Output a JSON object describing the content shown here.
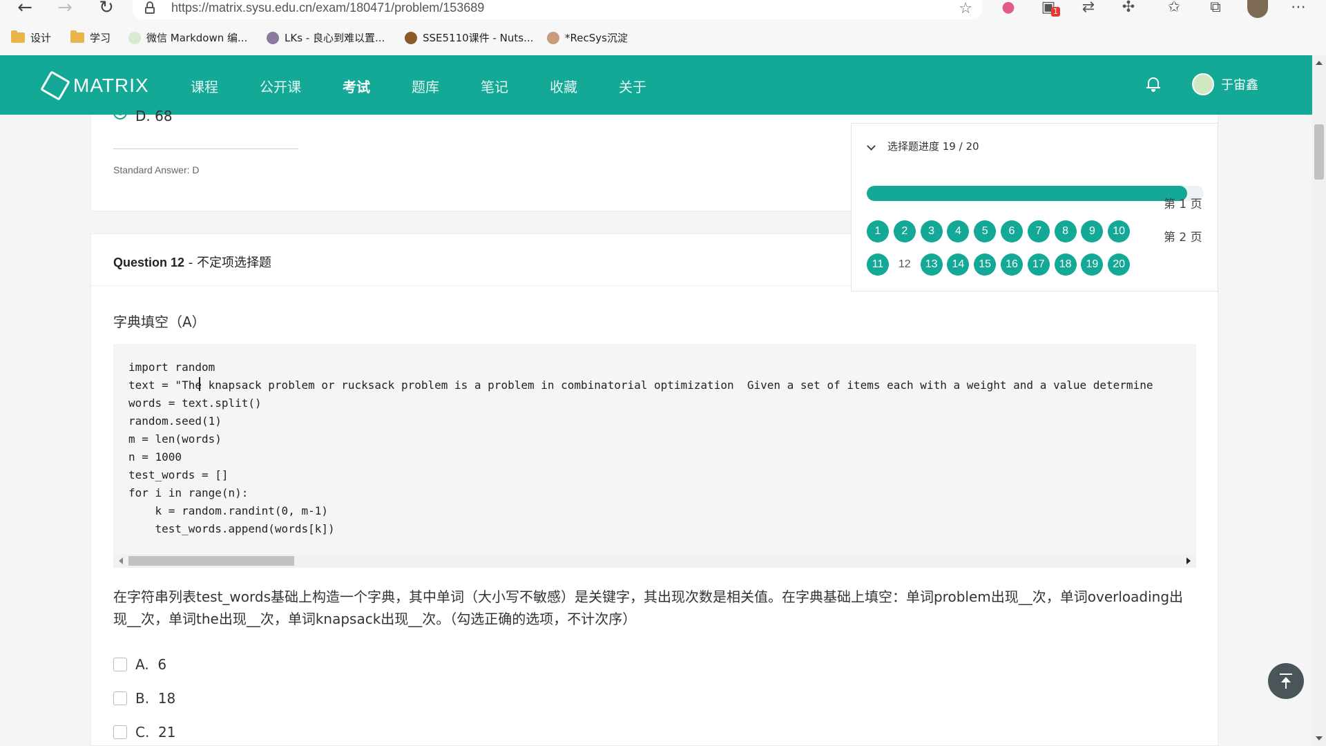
{
  "browser": {
    "url": "https://matrix.sysu.edu.cn/exam/180471/problem/153689",
    "extension_badge": "1",
    "bookmarks": [
      "设计",
      "学习",
      "微信 Markdown 编...",
      "LKs - 良心到难以置...",
      "SSE5110课件 - Nuts...",
      "*RecSys沉淀"
    ]
  },
  "header": {
    "logo": "MATRIX",
    "nav": [
      "课程",
      "公开课",
      "考试",
      "题库",
      "笔记",
      "收藏",
      "关于"
    ],
    "active_nav": "考试",
    "user_name": "于宙鑫"
  },
  "previous_question": {
    "selected_option": "D. 68",
    "standard_answer": "Standard Answer: D"
  },
  "question": {
    "title": "Question 12",
    "type": " - 不定项选择题",
    "subtitle": "字典填空（A）",
    "code_lines": [
      "import random",
      "text = \"The knapsack problem or rucksack problem is a problem in combinatorial optimization  Given a set of items each with a weight and a value determine",
      "words = text.split()",
      "random.seed(1)",
      "m = len(words)",
      "n = 1000",
      "test_words = []",
      "for i in range(n):",
      "    k = random.randint(0, m-1)",
      "    test_words.append(words[k])"
    ],
    "text": "在字符串列表test_words基础上构造一个字典，其中单词（大小写不敏感）是关键字，其出现次数是相关值。在字典基础上填空：单词problem出现__次，单词overloading出现__次，单词the出现__次，单词knapsack出现__次。（勾选正确的选项，不计次序）",
    "options": [
      {
        "label": "A.",
        "value": "6"
      },
      {
        "label": "B.",
        "value": "18"
      },
      {
        "label": "C.",
        "value": "21"
      }
    ]
  },
  "progress": {
    "title": "选择题进度 19 / 20",
    "fraction": 0.95,
    "pages": [
      {
        "label": "第 1 页",
        "numbers": [
          "1",
          "2",
          "3",
          "4",
          "5",
          "6",
          "7",
          "8",
          "9",
          "10"
        ]
      },
      {
        "label": "第 2 页",
        "numbers": [
          "11",
          "12",
          "13",
          "14",
          "15",
          "16",
          "17",
          "18",
          "19",
          "20"
        ]
      }
    ],
    "unanswered": [
      "12"
    ],
    "accent_color": "#13a996"
  }
}
